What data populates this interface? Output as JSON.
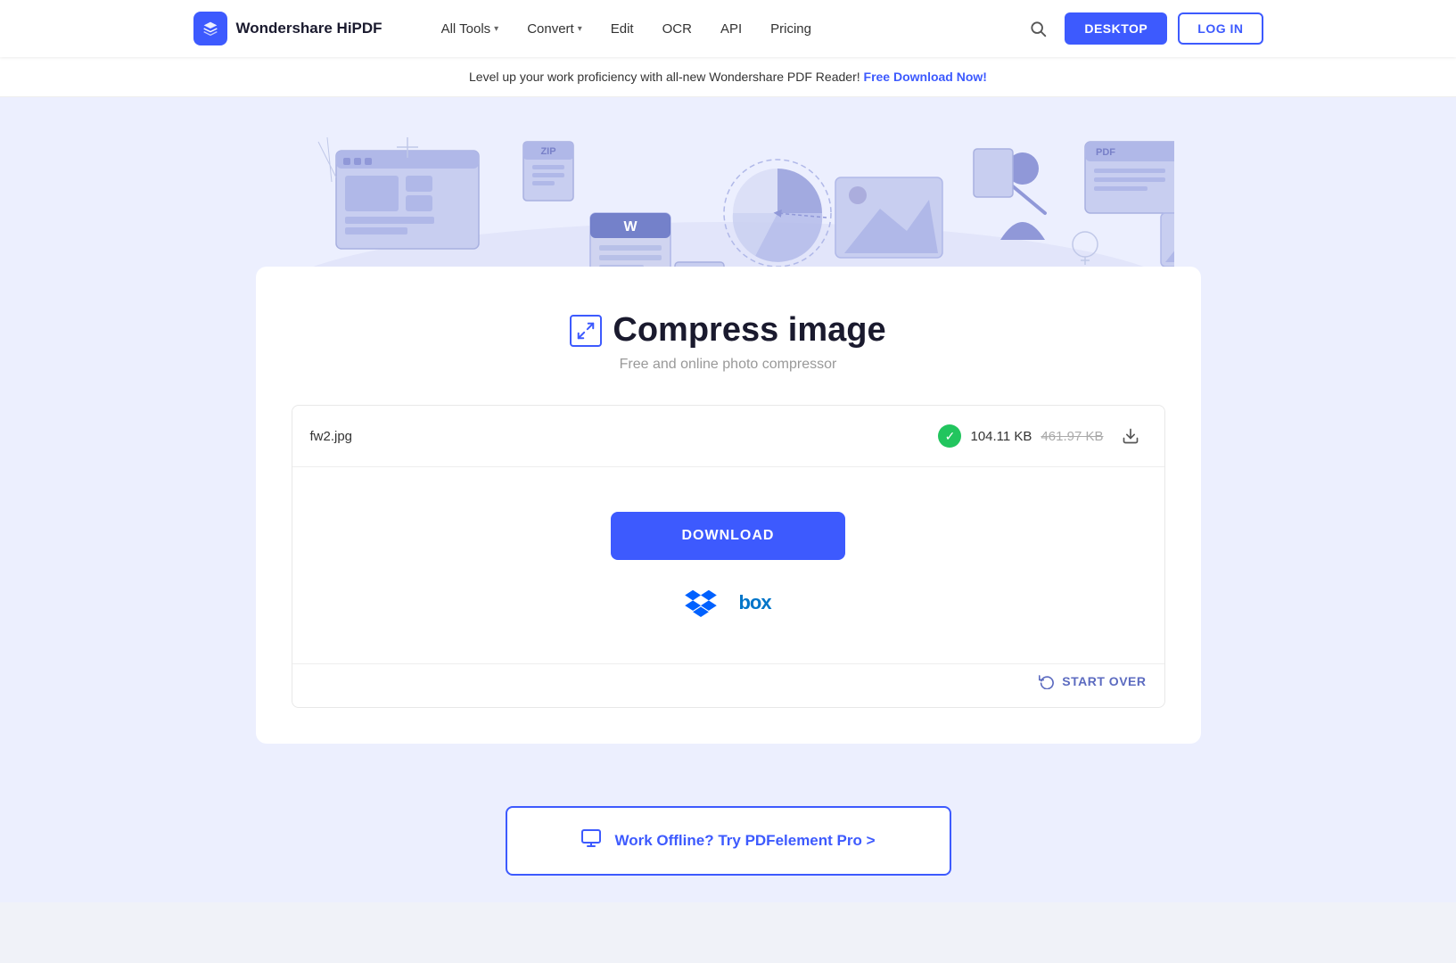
{
  "navbar": {
    "logo_text": "Wondershare HiPDF",
    "nav_items": [
      {
        "label": "All Tools",
        "has_dropdown": true
      },
      {
        "label": "Convert",
        "has_dropdown": true
      },
      {
        "label": "Edit",
        "has_dropdown": false
      },
      {
        "label": "OCR",
        "has_dropdown": false
      },
      {
        "label": "API",
        "has_dropdown": false
      },
      {
        "label": "Pricing",
        "has_dropdown": false
      }
    ],
    "btn_desktop": "DESKTOP",
    "btn_login": "LOG IN"
  },
  "banner": {
    "text": "Level up your work proficiency with all-new Wondershare PDF Reader!",
    "link_text": "Free Download Now!"
  },
  "hero": {
    "bg_color": "#eceffe"
  },
  "card": {
    "title_icon": "⇱",
    "title": "Compress image",
    "subtitle": "Free and online photo compressor",
    "file": {
      "name": "fw2.jpg",
      "new_size": "104.11 KB",
      "old_size": "461.97 KB"
    },
    "btn_download": "DOWNLOAD",
    "btn_start_over": "START OVER",
    "offline_banner": "Work Offline? Try PDFelement Pro >"
  }
}
